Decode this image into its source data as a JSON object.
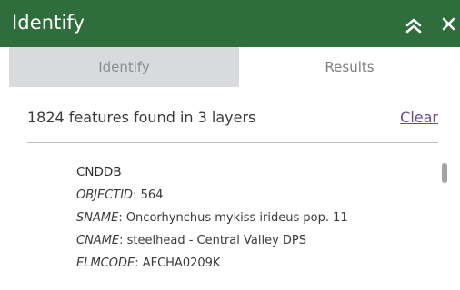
{
  "panel": {
    "title": "Identify",
    "collapse_icon": "double-chevron-up-icon",
    "close_icon": "close-icon",
    "header_color": "#2f6d3c"
  },
  "tabs": [
    {
      "label": "Identify",
      "active": false
    },
    {
      "label": "Results",
      "active": true
    }
  ],
  "summary": {
    "text": "1824 features found in 3 layers",
    "clear_label": "Clear"
  },
  "results": {
    "layer": "CNDDB",
    "attributes": [
      {
        "key": "OBJECTID",
        "sep": ": ",
        "value": "564"
      },
      {
        "key": "SNAME",
        "sep": ": ",
        "value": "Oncorhynchus mykiss irideus pop. 11"
      },
      {
        "key": "CNAME",
        "sep": ": ",
        "value": "steelhead - Central Valley DPS"
      },
      {
        "key": "ELMCODE",
        "sep": ": ",
        "value": "AFCHA0209K"
      }
    ]
  }
}
